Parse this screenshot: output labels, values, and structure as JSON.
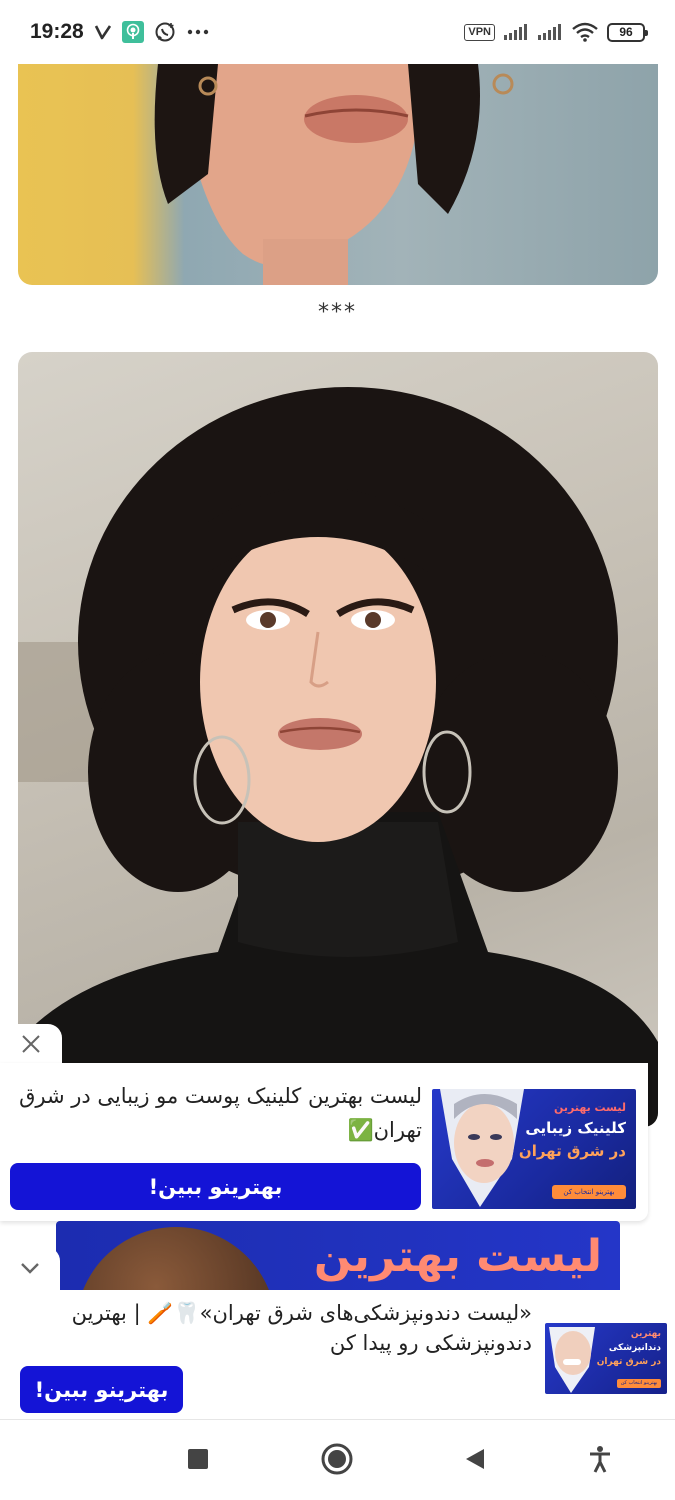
{
  "status_bar": {
    "time": "19:28",
    "icons": [
      "v-carrier-icon",
      "podcast-app-icon",
      "whatsapp-icon",
      "more-dots-icon"
    ],
    "vpn_label": "VPN",
    "battery_level": "96"
  },
  "content": {
    "separator": "***"
  },
  "ad1": {
    "text": "لیست بهترین کلینیک پوست مو زیبایی در شرق تهران✅",
    "button_label": "بهترینو ببین!",
    "banner": {
      "small_text": "لیست بهترین",
      "big_text_1": "کلینیک زیبایی",
      "big_text_2": "در شرق تهران",
      "pill_text": "بهترینو انتخاب کن"
    }
  },
  "banner_strip": {
    "text": "لیست بهترین"
  },
  "ad2": {
    "text": "«لیست دندونپزشکی‌های شرق تهران»🦷🪥 | بهترین دندونپزشکی رو پیدا کن",
    "button_label": "بهترینو ببین!",
    "banner": {
      "small_text": "بهترین",
      "white_text": "دندانپزشکی",
      "orange_text": "در شرق تهران",
      "pill_text": "بهترینو انتخاب کن"
    }
  },
  "colors": {
    "accent_button": "#1414d6",
    "banner_blue": "#2639c9",
    "banner_orange": "#ff8c3a"
  }
}
